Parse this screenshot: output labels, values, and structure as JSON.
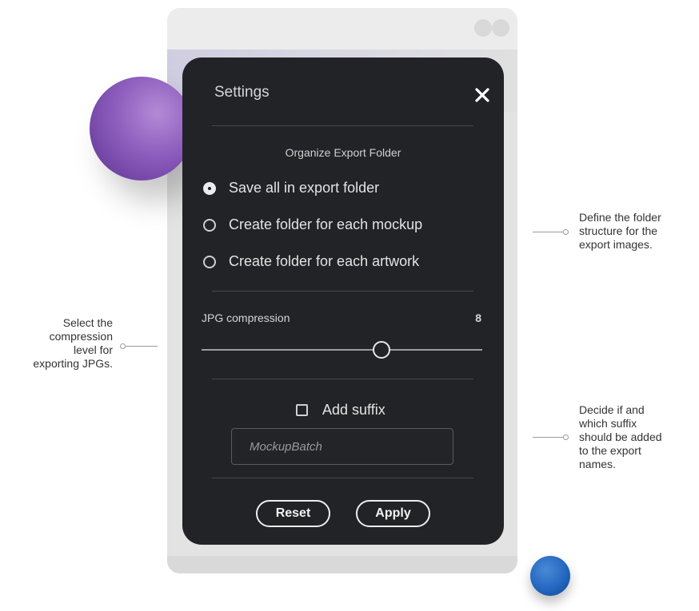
{
  "dialog": {
    "title": "Settings",
    "close_icon": "close-icon",
    "organize_section_title": "Organize Export Folder",
    "folder_options": [
      {
        "label": "Save all in export folder",
        "checked": true
      },
      {
        "label": "Create folder for each mockup",
        "checked": false
      },
      {
        "label": "Create folder for each artwork",
        "checked": false
      }
    ],
    "jpg_compression": {
      "label": "JPG compression",
      "value": "8",
      "level_fraction": 0.64
    },
    "suffix": {
      "checkbox_label": "Add suffix",
      "checked": false,
      "placeholder": "MockupBatch"
    },
    "buttons": {
      "reset_label": "Reset",
      "apply_label": "Apply"
    }
  },
  "annotations": {
    "compression": [
      "Select the",
      "compression",
      "level for",
      "exporting JPGs."
    ],
    "folder_structure": [
      "Define the folder",
      "structure for the",
      "export images."
    ],
    "suffix": [
      "Decide if and",
      "which suffix",
      "should be added",
      "to the export",
      "names."
    ]
  },
  "colors": {
    "dialog_bg": "#222326",
    "text": "#e3e3e3",
    "accent_purple": "#8c5dbc",
    "accent_blue": "#2367c1"
  }
}
